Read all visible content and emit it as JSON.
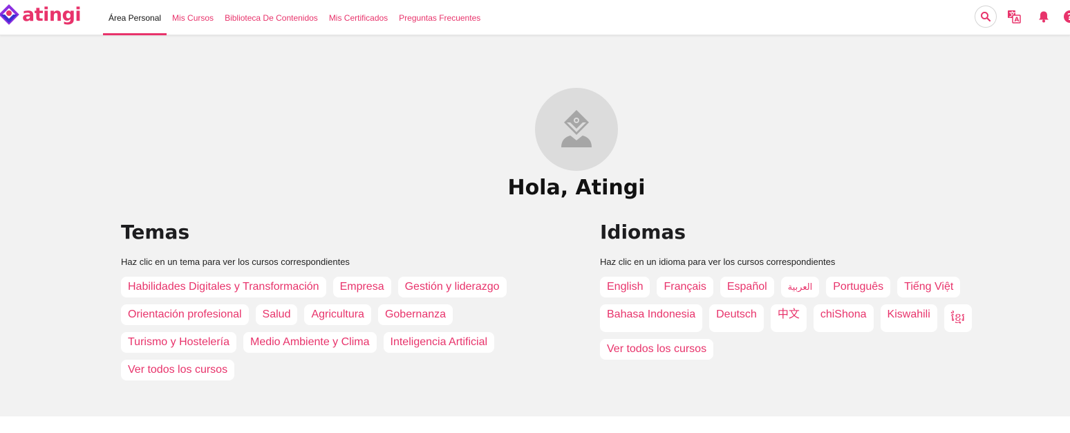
{
  "theme": {
    "accent": "#e8336b",
    "logo_blue": "#3a2fd1",
    "logo_purple": "#8b2fe0",
    "background": "#f2f2f2",
    "nav_active_text": "#111111",
    "avatar_bg": "#dcdcdc",
    "avatar_icon": "#a6a6a6"
  },
  "brand": {
    "name": "atingi"
  },
  "nav": {
    "items": [
      {
        "label": "Área Personal",
        "active": true
      },
      {
        "label": "Mis Cursos",
        "active": false
      },
      {
        "label": "Biblioteca De Contenidos",
        "active": false
      },
      {
        "label": "Mis Certificados",
        "active": false
      },
      {
        "label": "Preguntas Frecuentes",
        "active": false
      }
    ]
  },
  "header_icons": [
    "search-icon",
    "translate-icon",
    "bell-icon",
    "help-icon"
  ],
  "profile": {
    "greeting": "Hola, Atingi"
  },
  "topics": {
    "title": "Temas",
    "hint": "Haz clic en un tema para ver los cursos correspondientes",
    "items": [
      "Habilidades Digitales y Transformación",
      "Empresa",
      "Gestión y liderazgo",
      "Orientación profesional",
      "Salud",
      "Agricultura",
      "Gobernanza",
      "Turismo y Hostelería",
      "Medio Ambiente y Clima",
      "Inteligencia Artificial"
    ],
    "view_all": "Ver todos los cursos"
  },
  "languages": {
    "title": "Idiomas",
    "hint": "Haz clic en un idioma para ver los cursos correspondientes",
    "items": [
      "English",
      "Français",
      "Español",
      "العربية",
      "Português",
      "Tiếng Việt",
      "Bahasa Indonesia",
      "Deutsch",
      "中文",
      "chiShona",
      "Kiswahili",
      "ខ្មែរ"
    ],
    "view_all": "Ver todos los cursos"
  }
}
